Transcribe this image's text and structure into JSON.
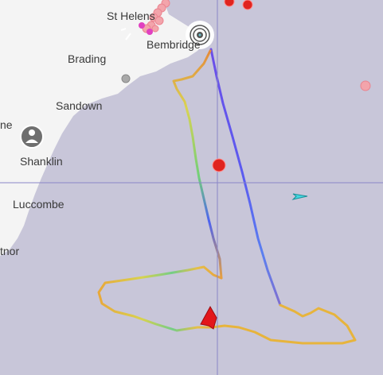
{
  "map": {
    "colors": {
      "sea": "#c8c6d9",
      "land": "#f4f4f4",
      "crosshair": "#8a86c8",
      "boat": "#e3161b",
      "vessel_marker": "#e0241f",
      "ais_target": "#f0a0a8",
      "heading_target": "#43d7e0"
    },
    "places": [
      {
        "name": "St Helens"
      },
      {
        "name": "Bembridge"
      },
      {
        "name": "Brading"
      },
      {
        "name": "Sandown"
      },
      {
        "name": "Shanklin"
      },
      {
        "name": "Luccombe"
      },
      {
        "name": "ne"
      },
      {
        "name": "tnor"
      }
    ],
    "icons": {
      "user_location": "person-icon",
      "start_marker": "target-icon",
      "boat": "boat-icon",
      "heading_arrow": "arrow-icon"
    }
  }
}
